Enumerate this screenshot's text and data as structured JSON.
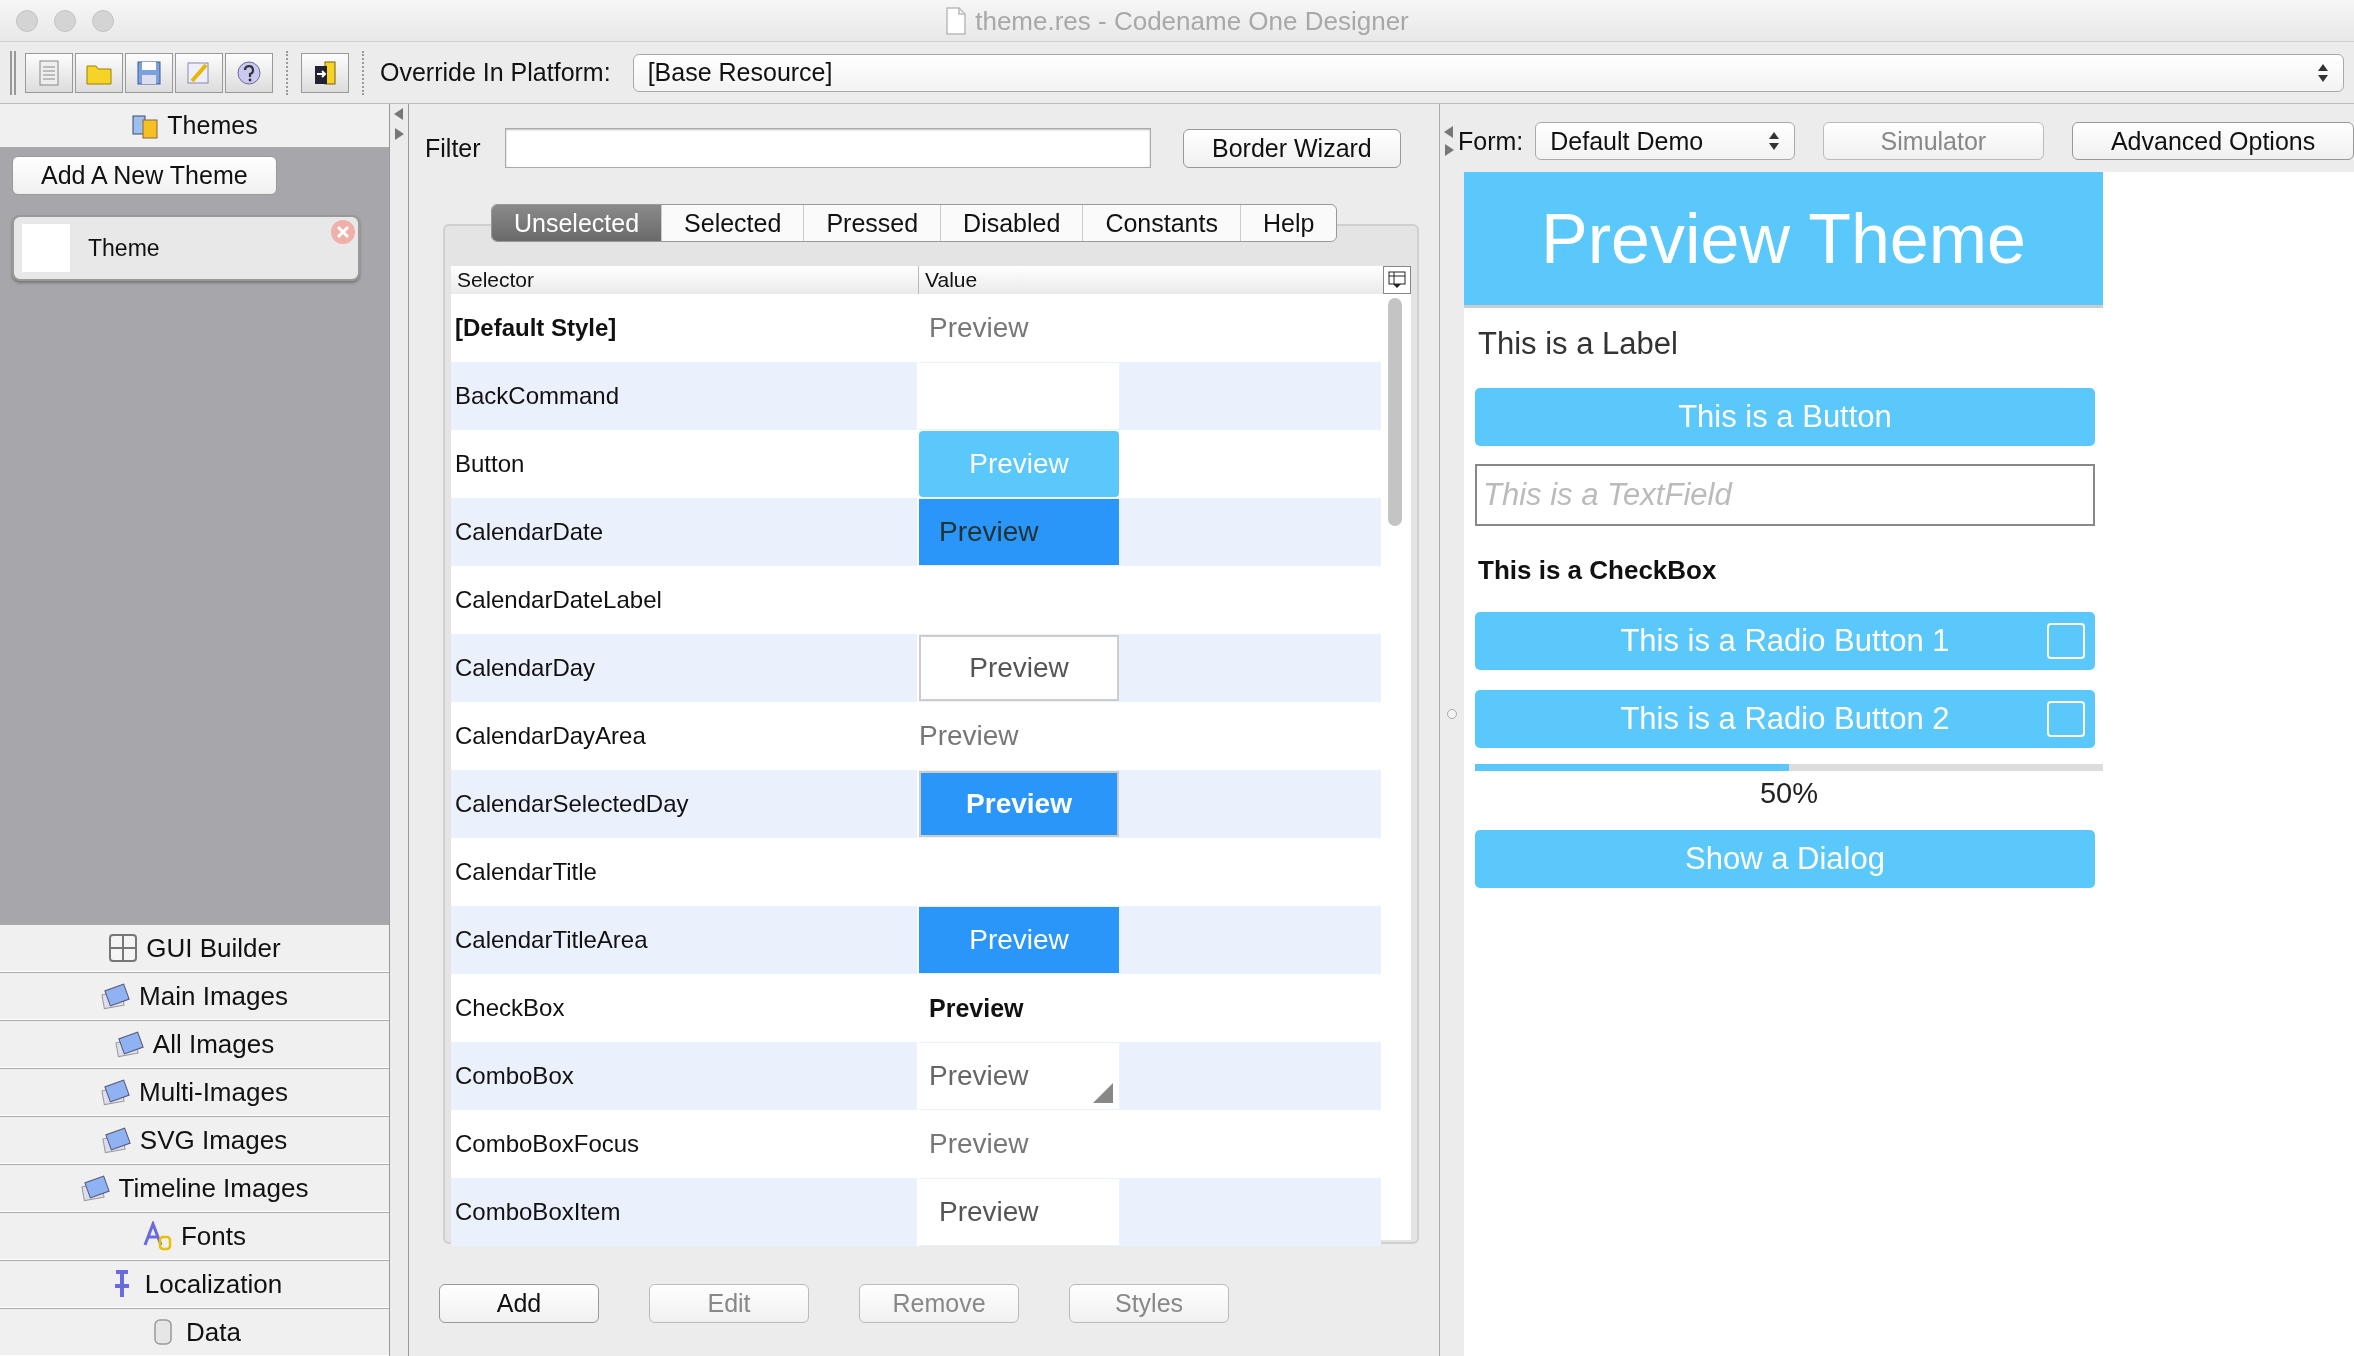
{
  "window": {
    "title": "theme.res - Codename One Designer"
  },
  "toolbar": {
    "override_label": "Override In Platform:",
    "platform": "[Base Resource]"
  },
  "sidebar": {
    "header": "Themes",
    "add_button": "Add A New Theme",
    "themes": [
      {
        "name": "Theme",
        "selected": true
      }
    ],
    "nav": [
      {
        "label": "GUI Builder",
        "kind": "grid"
      },
      {
        "label": "Main Images",
        "kind": "images"
      },
      {
        "label": "All Images",
        "kind": "images"
      },
      {
        "label": "Multi-Images",
        "kind": "images"
      },
      {
        "label": "SVG Images",
        "kind": "images"
      },
      {
        "label": "Timeline Images",
        "kind": "images"
      },
      {
        "label": "Fonts",
        "kind": "fonts"
      },
      {
        "label": "Localization",
        "kind": "pin"
      },
      {
        "label": "Data",
        "kind": "data"
      }
    ]
  },
  "editor": {
    "filter_label": "Filter",
    "border_wizard": "Border Wizard",
    "tabs": [
      {
        "label": "Unselected",
        "selected": true
      },
      {
        "label": "Selected",
        "selected": false
      },
      {
        "label": "Pressed",
        "selected": false
      },
      {
        "label": "Disabled",
        "selected": false
      },
      {
        "label": "Constants",
        "selected": false
      },
      {
        "label": "Help",
        "selected": false
      }
    ],
    "table": {
      "columns": [
        "Selector",
        "Value"
      ],
      "rows": [
        {
          "selector": "[Default Style]",
          "bold": true,
          "preview": {
            "kind": "plain",
            "text": "Preview"
          }
        },
        {
          "selector": "BackCommand",
          "bold": false,
          "preview": {
            "kind": "blank"
          }
        },
        {
          "selector": "Button",
          "bold": false,
          "preview": {
            "kind": "button",
            "text": "Preview"
          }
        },
        {
          "selector": "CalendarDate",
          "bold": false,
          "preview": {
            "kind": "date",
            "text": "Preview"
          }
        },
        {
          "selector": "CalendarDateLabel",
          "bold": false,
          "preview": {
            "kind": "none"
          }
        },
        {
          "selector": "CalendarDay",
          "bold": false,
          "preview": {
            "kind": "day",
            "text": "Preview"
          }
        },
        {
          "selector": "CalendarDayArea",
          "bold": false,
          "preview": {
            "kind": "flush",
            "text": "Preview"
          }
        },
        {
          "selector": "CalendarSelectedDay",
          "bold": false,
          "preview": {
            "kind": "selected-day",
            "text": "Preview"
          }
        },
        {
          "selector": "CalendarTitle",
          "bold": false,
          "preview": {
            "kind": "none"
          }
        },
        {
          "selector": "CalendarTitleArea",
          "bold": false,
          "preview": {
            "kind": "title-area",
            "text": "Preview"
          }
        },
        {
          "selector": "CheckBox",
          "bold": false,
          "preview": {
            "kind": "bold",
            "text": "Preview"
          }
        },
        {
          "selector": "ComboBox",
          "bold": false,
          "preview": {
            "kind": "combo",
            "text": "Preview"
          }
        },
        {
          "selector": "ComboBoxFocus",
          "bold": false,
          "preview": {
            "kind": "plain",
            "text": "Preview"
          }
        },
        {
          "selector": "ComboBoxItem",
          "bold": false,
          "preview": {
            "kind": "item",
            "text": "Preview"
          }
        }
      ]
    },
    "buttons": [
      {
        "label": "Add",
        "disabled": false
      },
      {
        "label": "Edit",
        "disabled": true
      },
      {
        "label": "Remove",
        "disabled": true
      },
      {
        "label": "Styles",
        "disabled": true
      }
    ]
  },
  "form_panel": {
    "form_label": "Form:",
    "form_value": "Default Demo",
    "buttons": [
      {
        "label": "Simulator",
        "disabled": true
      },
      {
        "label": "Advanced Options",
        "disabled": false
      }
    ],
    "preview": {
      "title": "Preview Theme",
      "items": [
        {
          "kind": "label",
          "text": "This is a Label"
        },
        {
          "kind": "button",
          "text": "This is a Button"
        },
        {
          "kind": "textfield",
          "placeholder": "This is a TextField"
        },
        {
          "kind": "checkbox",
          "text": "This is a CheckBox",
          "checked": false
        },
        {
          "kind": "radio",
          "text": "This is a Radio Button 1",
          "selected": false
        },
        {
          "kind": "radio",
          "text": "This is a Radio Button 2",
          "selected": false
        },
        {
          "kind": "progress",
          "level": 0.5,
          "text": "50%"
        },
        {
          "kind": "button",
          "text": "Show a Dialog"
        }
      ]
    }
  }
}
